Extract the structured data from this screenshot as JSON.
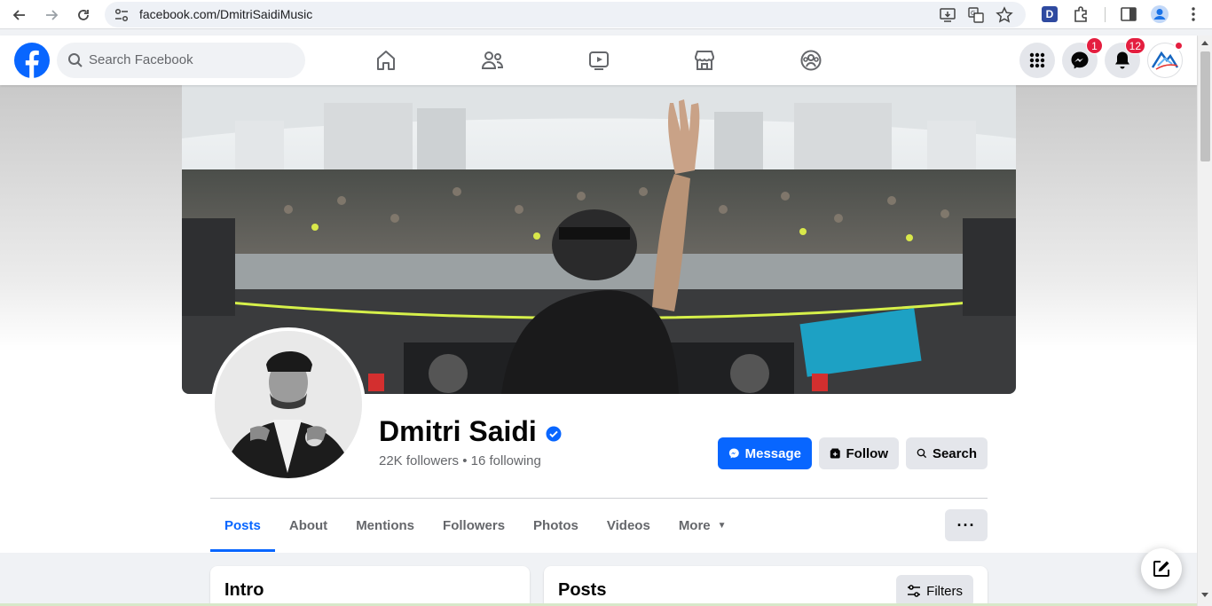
{
  "browser": {
    "url": "facebook.com/DmitriSaidiMusic",
    "extension_letter": "D"
  },
  "header": {
    "search_placeholder": "Search Facebook",
    "messenger_badge": "1",
    "notifications_badge": "12"
  },
  "profile": {
    "name": "Dmitri Saidi",
    "stats": "22K followers • 16 following",
    "message_label": "Message",
    "follow_label": "Follow",
    "search_label": "Search"
  },
  "tabs": [
    {
      "label": "Posts",
      "active": true
    },
    {
      "label": "About"
    },
    {
      "label": "Mentions"
    },
    {
      "label": "Followers"
    },
    {
      "label": "Photos"
    },
    {
      "label": "Videos"
    },
    {
      "label": "More"
    }
  ],
  "intro_title": "Intro",
  "posts_title": "Posts",
  "filters_label": "Filters",
  "colors": {
    "brand_blue": "#0866ff",
    "badge_red": "#e41e3f",
    "secondary_button": "#e4e6eb"
  }
}
